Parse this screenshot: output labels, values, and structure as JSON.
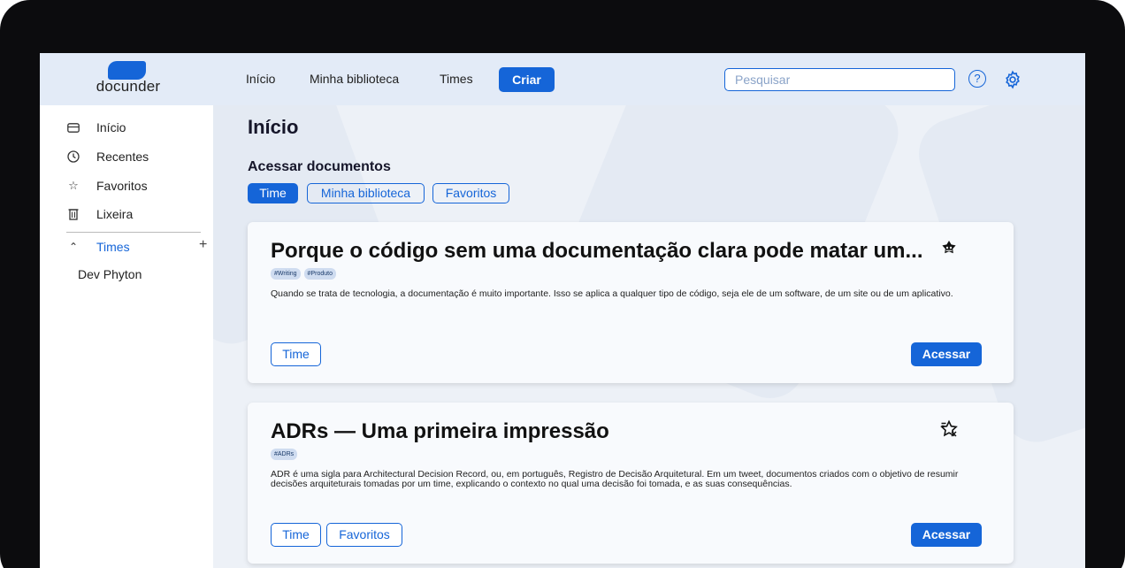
{
  "brand": {
    "name": "docunder",
    "color": "#1565d8"
  },
  "nav": {
    "items": [
      "Início",
      "Minha biblioteca",
      "Times"
    ],
    "create_label": "Criar"
  },
  "search": {
    "placeholder": "Pesquisar",
    "value": ""
  },
  "icons": {
    "help": "help-circle-icon",
    "settings": "gear-icon"
  },
  "sidebar": {
    "items": [
      {
        "label": "Início",
        "icon": "card-icon"
      },
      {
        "label": "Recentes",
        "icon": "clock-icon"
      },
      {
        "label": "Favoritos",
        "icon": "star-icon"
      },
      {
        "label": "Lixeira",
        "icon": "trash-icon"
      }
    ],
    "times": {
      "label": "Times",
      "expanded": true,
      "add_icon": "plus-icon",
      "children": [
        "Dev Phyton"
      ]
    }
  },
  "main": {
    "title": "Início",
    "section_title": "Acessar documentos",
    "filters": [
      {
        "label": "Time",
        "active": true
      },
      {
        "label": "Minha biblioteca",
        "active": false
      },
      {
        "label": "Favoritos",
        "active": false
      }
    ],
    "cards": [
      {
        "title": "Porque o código sem uma documentação clara pode matar um...",
        "tags": [
          "#Writing",
          "#Produto"
        ],
        "description": "Quando se trata de tecnologia, a documentação é muito importante. Isso se aplica a qualquer tipo de código, seja ele de um software, de um site ou de um aplicativo.",
        "icon": "team-badge-icon",
        "labels": [
          "Time"
        ],
        "action": "Acessar"
      },
      {
        "title": "ADRs — Uma primeira impressão",
        "tags": [
          "#ADRs"
        ],
        "description": "ADR é uma sigla para Architectural Decision Record, ou, em português, Registro de Decisão Arquitetural. Em um tweet, documentos criados com o objetivo de resumir decisões arquiteturais tomadas por um time, explicando o contexto no qual uma decisão foi tomada, e as suas consequências.",
        "icon": "favorite-star-icon",
        "labels": [
          "Time",
          "Favoritos"
        ],
        "action": "Acessar"
      }
    ]
  }
}
